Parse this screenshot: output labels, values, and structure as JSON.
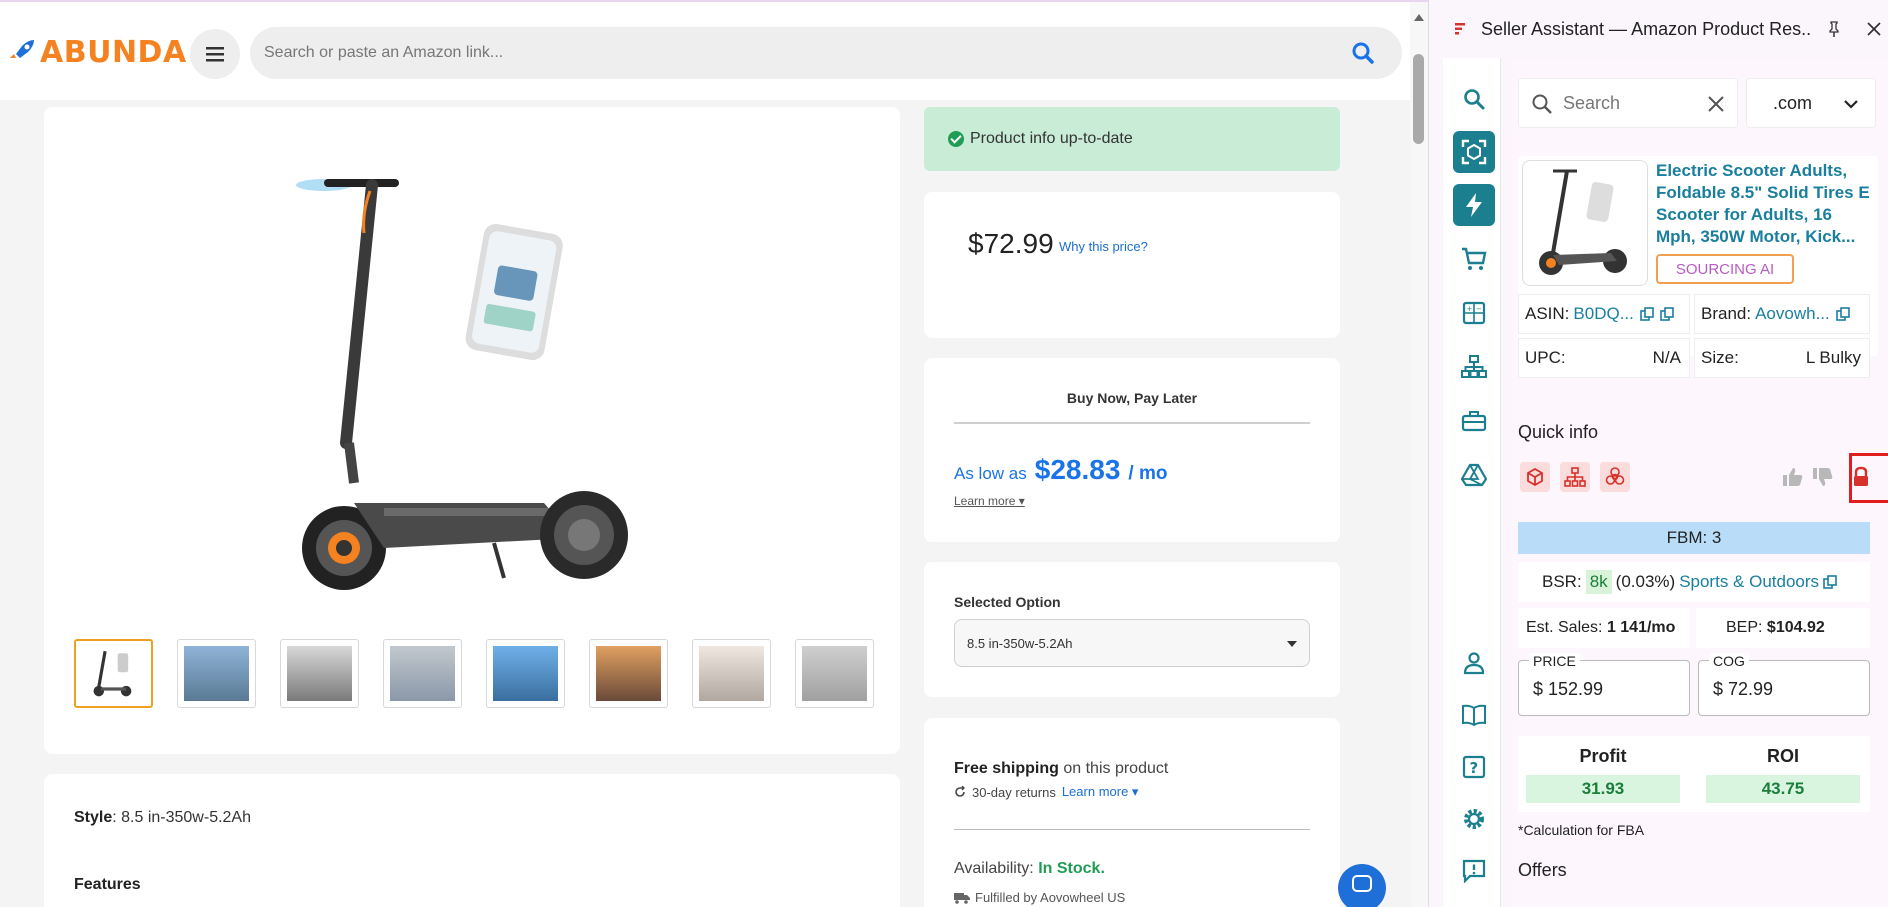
{
  "site": {
    "logo_text": "ABUNDA",
    "search_placeholder": "Search or paste an Amazon link..."
  },
  "status": {
    "text": "Product info up-to-date"
  },
  "price": {
    "value": "$72.99",
    "why_link": "Why this price?"
  },
  "bnpl": {
    "title": "Buy Now, Pay Later",
    "as_low_as": "As low as",
    "amount": "$28.83",
    "per": "/ mo",
    "learn_more": "Learn more"
  },
  "option": {
    "label": "Selected Option",
    "value": "8.5 in-350w-5.2Ah"
  },
  "details": {
    "style_label": "Style",
    "style_value": ": 8.5 in-350w-5.2Ah",
    "features": "Features"
  },
  "shipping": {
    "free": "Free shipping",
    "on_product": " on this product",
    "returns": "30-day returns",
    "learn_more": "Learn more",
    "availability_label": "Availability:",
    "availability_value": "In Stock.",
    "fulfilled": "Fulfilled by Aovowheel US"
  },
  "gallery": {
    "thumb_count": 8,
    "selected_index": 0
  },
  "panel": {
    "title": "Seller Assistant — Amazon Product Res...",
    "search_placeholder": "Search",
    "domain": ".com",
    "product_title": "Electric Scooter Adults, Foldable 8.5\" Solid Tires E Scooter for Adults, 16 Mph, 350W Motor, Kick...",
    "sourcing_label": "SOURCING AI",
    "asin_label": "ASIN:",
    "asin_value": "B0DQ...",
    "brand_label": "Brand:",
    "brand_value": "Aovowh...",
    "upc_label": "UPC:",
    "upc_value": "N/A",
    "size_label": "Size:",
    "size_value": "L Bulky",
    "quick_info_title": "Quick info",
    "fbm": "FBM: 3",
    "bsr_label": "BSR:",
    "bsr_rank": "8k",
    "bsr_pct": "(0.03%)",
    "bsr_category": "Sports & Outdoors",
    "est_sales_label": "Est. Sales:",
    "est_sales_value": "1 141/mo",
    "bep_label": "BEP:",
    "bep_value": "$104.92",
    "price_label": "PRICE",
    "price_value": "$ 152.99",
    "cog_label": "COG",
    "cog_value": "$ 72.99",
    "profit_label": "Profit",
    "profit_value": "31.93",
    "roi_label": "ROI",
    "roi_value": "43.75",
    "calc_note": "*Calculation for FBA",
    "offers_title": "Offers"
  },
  "colors": {
    "brand_orange": "#f58220",
    "accent_teal": "#1c7f8f",
    "link_blue": "#1a73e8",
    "in_stock_green": "#1f9d55",
    "highlight_red": "#e11d1d"
  },
  "icons": {
    "rail": [
      "search-icon",
      "scan-icon",
      "lightning-icon",
      "cart-icon",
      "calculator-icon",
      "hierarchy-icon",
      "toolbox-icon",
      "drive-icon",
      "user-icon",
      "book-icon",
      "help-icon",
      "gear-icon",
      "feedback-icon"
    ],
    "quick_info": [
      "package-icon",
      "hierarchy-icon",
      "biohazard-icon",
      "thumbs-up-icon",
      "thumbs-down-icon",
      "lock-icon"
    ]
  }
}
